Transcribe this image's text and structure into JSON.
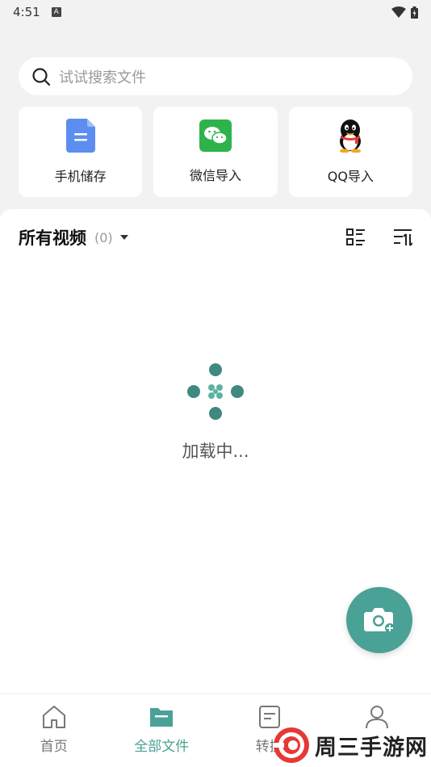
{
  "status_bar": {
    "time": "4:51",
    "indicator": "A"
  },
  "search": {
    "placeholder": "试试搜索文件"
  },
  "sources": [
    {
      "label": "手机储存",
      "icon": "phone-storage-icon"
    },
    {
      "label": "微信导入",
      "icon": "wechat-icon"
    },
    {
      "label": "QQ导入",
      "icon": "qq-icon"
    }
  ],
  "panel": {
    "title": "所有视频",
    "count": "(0)"
  },
  "loading": {
    "text": "加载中..."
  },
  "bottom_nav": [
    {
      "label": "首页",
      "icon": "home-icon",
      "active": false
    },
    {
      "label": "全部文件",
      "icon": "folder-icon",
      "active": true
    },
    {
      "label": "转换",
      "icon": "document-icon",
      "active": false
    },
    {
      "label": "",
      "icon": "person-icon",
      "active": false
    }
  ],
  "watermark": {
    "text": "周三手游网"
  },
  "colors": {
    "accent": "#4aa195",
    "background": "#f2f2f2"
  }
}
